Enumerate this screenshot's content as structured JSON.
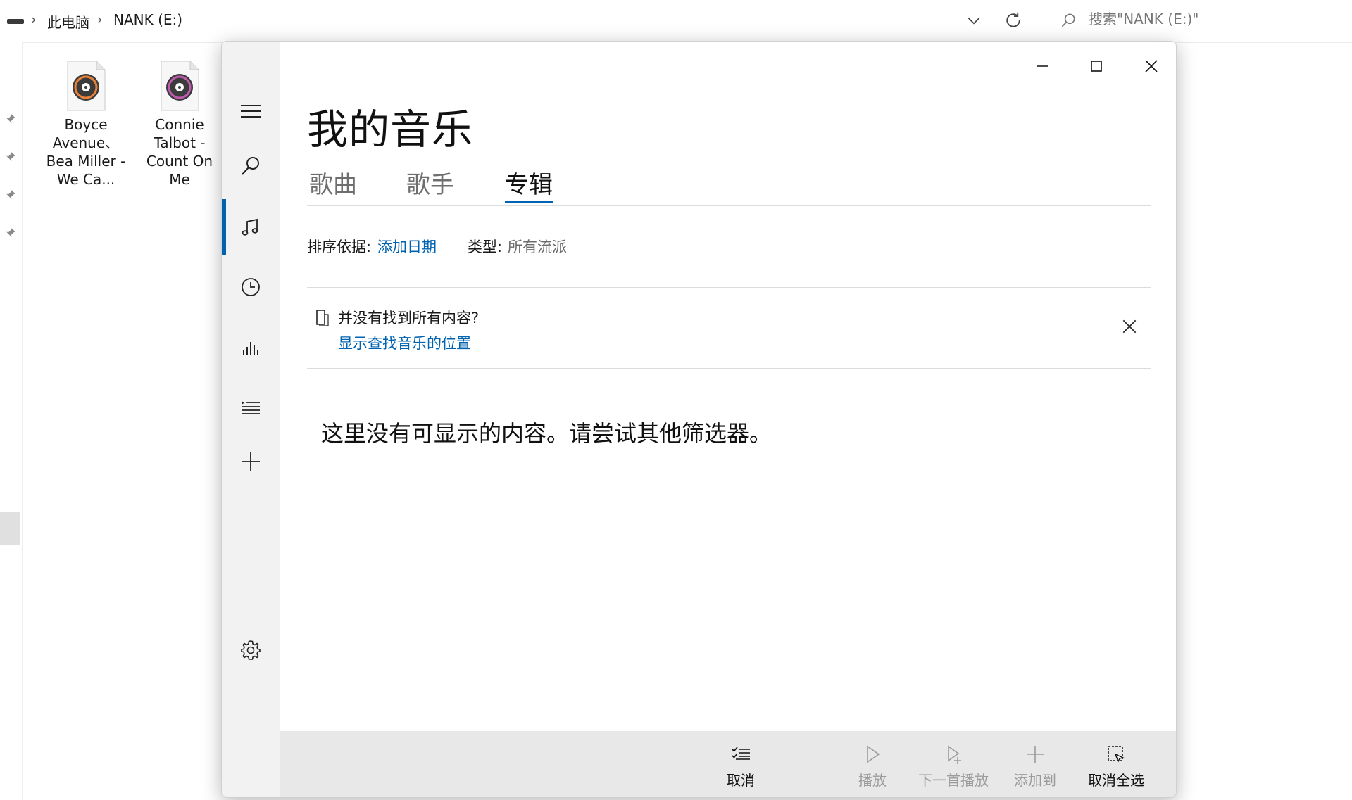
{
  "explorer": {
    "breadcrumb": [
      "此电脑",
      "NANK (E:)"
    ],
    "search_placeholder": "搜索\"NANK (E:)\"",
    "files": [
      {
        "name": "Boyce Avenue、Bea Miller - We Ca..."
      },
      {
        "name": "Connie Talbot - Count On Me"
      }
    ]
  },
  "app": {
    "title": "我的音乐",
    "tabs": [
      {
        "label": "歌曲",
        "active": false
      },
      {
        "label": "歌手",
        "active": false
      },
      {
        "label": "专辑",
        "active": true
      }
    ],
    "sort": {
      "label": "排序依据:",
      "value": "添加日期"
    },
    "genre": {
      "label": "类型:",
      "value": "所有流派"
    },
    "notice": {
      "text": "并没有找到所有内容?",
      "link": "显示查找音乐的位置"
    },
    "empty_message": "这里没有可显示的内容。请尝试其他筛选器。",
    "nav_icons": [
      "hamburger-icon",
      "search-icon",
      "music-note-icon",
      "recent-clock-icon",
      "now-playing-bars-icon",
      "playlist-icon",
      "add-icon",
      "settings-gear-icon"
    ],
    "commands": [
      {
        "label": "取消",
        "enabled": true
      },
      {
        "label": "播放",
        "enabled": false
      },
      {
        "label": "下一首播放",
        "enabled": false
      },
      {
        "label": "添加到",
        "enabled": false
      },
      {
        "label": "取消全选",
        "enabled": true
      }
    ],
    "accent_color": "#0063b1"
  }
}
